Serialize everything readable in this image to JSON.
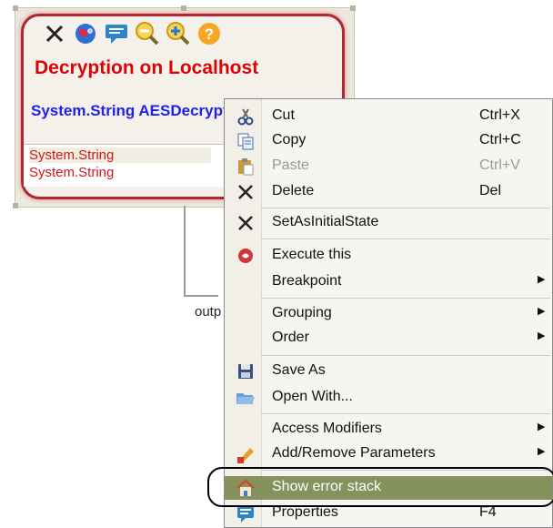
{
  "node": {
    "title": "Decryption on Localhost",
    "signature": "System.String AESDecrypt",
    "params": [
      "System.String",
      "System.String"
    ],
    "output_label": "outp",
    "toolbar_icons": [
      "close-icon",
      "globe-icon",
      "comment-icon",
      "zoom-out-icon",
      "zoom-in-icon",
      "help-icon"
    ]
  },
  "menu": {
    "items": [
      {
        "label": "Cut",
        "shortcut": "Ctrl+X",
        "icon": "scissors-icon"
      },
      {
        "label": "Copy",
        "shortcut": "Ctrl+C",
        "icon": "copy-icon"
      },
      {
        "label": "Paste",
        "shortcut": "Ctrl+V",
        "icon": "paste-icon",
        "disabled": true
      },
      {
        "label": "Delete",
        "shortcut": "Del",
        "icon": "delete-icon"
      },
      {
        "label": "SetAsInitialState",
        "icon": "x-icon"
      },
      {
        "label": "Execute this",
        "icon": "execute-icon"
      },
      {
        "label": "Breakpoint",
        "submenu": true
      },
      {
        "label": "Grouping",
        "submenu": true
      },
      {
        "label": "Order",
        "submenu": true
      },
      {
        "label": "Save As",
        "icon": "save-icon"
      },
      {
        "label": "Open With...",
        "icon": "folder-icon"
      },
      {
        "label": "Access Modifiers",
        "submenu": true
      },
      {
        "label": "Add/Remove Parameters",
        "icon": "edit-icon",
        "submenu": true
      },
      {
        "label": "Show error stack",
        "icon": "home-icon",
        "highlighted": true
      },
      {
        "label": "Properties",
        "shortcut": "F4",
        "icon": "properties-icon"
      }
    ],
    "highlight_color": "#86925e"
  }
}
